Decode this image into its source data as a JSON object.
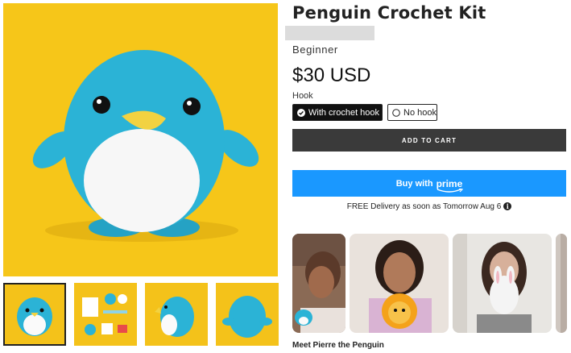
{
  "product": {
    "title": "Penguin Crochet Kit",
    "level": "Beginner",
    "price": "$30 USD"
  },
  "images": {
    "main": "penguin-main-image",
    "thumbnails": [
      {
        "name": "penguin-front-thumbnail",
        "active": true
      },
      {
        "name": "kit-contents-thumbnail",
        "active": false
      },
      {
        "name": "penguin-side-thumbnail",
        "active": false
      },
      {
        "name": "penguin-back-thumbnail",
        "active": false
      }
    ]
  },
  "hook_option": {
    "label": "Hook",
    "options": [
      {
        "label": "With crochet hook",
        "selected": true
      },
      {
        "label": "No hook",
        "selected": false
      }
    ]
  },
  "actions": {
    "add_to_cart": "ADD TO CART",
    "buy_with": "Buy with",
    "prime": "prime"
  },
  "delivery": {
    "text": "FREE Delivery as soon as Tomorrow Aug 6",
    "info_icon": "info-icon"
  },
  "videos": {
    "title": "Meet Pierre the Penguin",
    "cards": [
      "video-thumbnail-1",
      "video-thumbnail-2",
      "video-thumbnail-3",
      "video-thumbnail-4"
    ]
  },
  "colors": {
    "background_yellow": "#f6c619",
    "penguin_blue": "#2bb3d6",
    "add_to_cart_bg": "#3a3a3a",
    "prime_button_bg": "#1a98ff",
    "selected_option_bg": "#111111"
  }
}
